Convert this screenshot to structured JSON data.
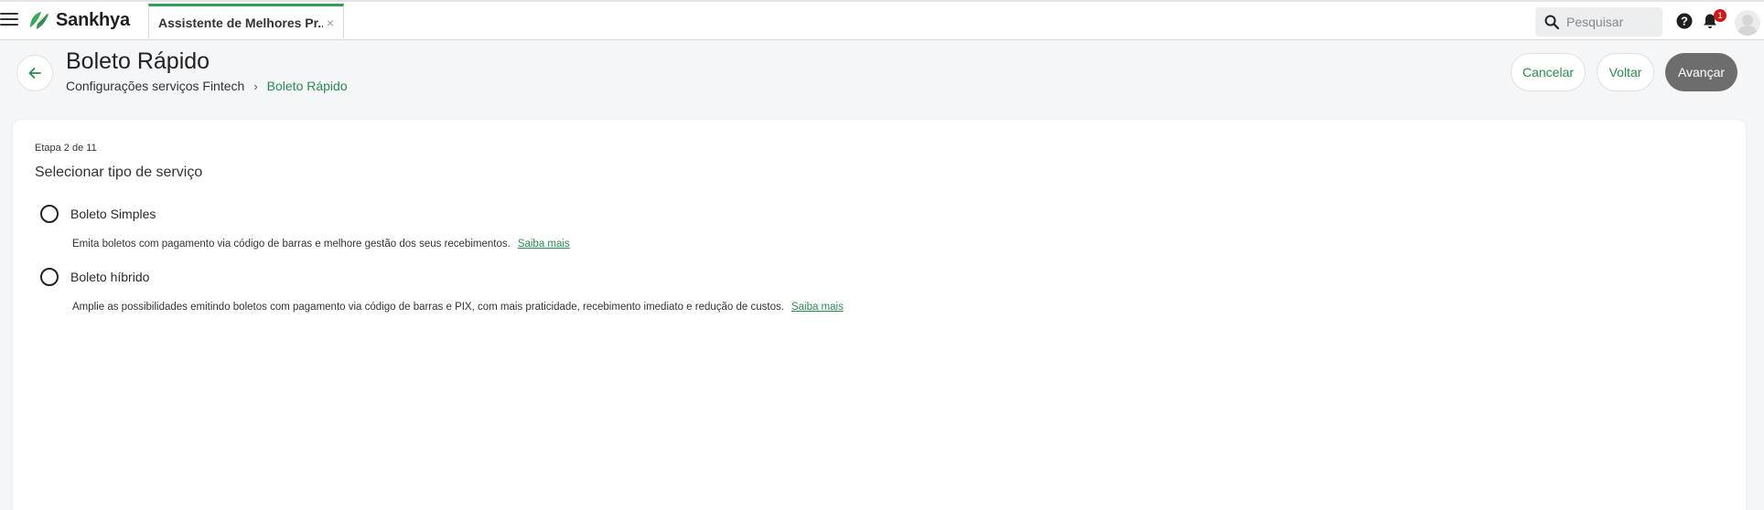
{
  "topbar": {
    "brand": "Sankhya",
    "tab_label": "Assistente de Melhores Pr...",
    "tab_close": "×",
    "search_placeholder": "Pesquisar",
    "notification_count": "1"
  },
  "header": {
    "title": "Boleto Rápido",
    "breadcrumb_parent": "Configurações serviços Fintech",
    "breadcrumb_separator": "›",
    "breadcrumb_current": "Boleto Rápido",
    "buttons": {
      "cancel": "Cancelar",
      "back": "Voltar",
      "next": "Avançar"
    }
  },
  "wizard": {
    "step": "Etapa 2 de 11",
    "section_title": "Selecionar tipo de serviço",
    "options": [
      {
        "label": "Boleto Simples",
        "description": "Emita boletos com pagamento via código de barras e melhore gestão dos seus recebimentos.",
        "link": "Saiba mais",
        "selected": false
      },
      {
        "label": "Boleto híbrido",
        "description": "Amplie as possibilidades emitindo boletos com pagamento via código de barras e PIX, com mais praticidade, recebimento imediato e redução de custos.",
        "link": "Saiba mais",
        "selected": false
      }
    ]
  },
  "colors": {
    "accent": "#2a8a53",
    "tab_indicator": "#2e9e5b",
    "primary_button": "#6d6d6d",
    "badge": "#d0191c"
  },
  "icons": {
    "menu": "hamburger-icon",
    "logo": "sankhya-leaf-logo",
    "search": "search-icon",
    "help": "help-icon",
    "notifications": "bell-icon",
    "avatar": "user-avatar-icon",
    "back": "arrow-left-icon"
  }
}
